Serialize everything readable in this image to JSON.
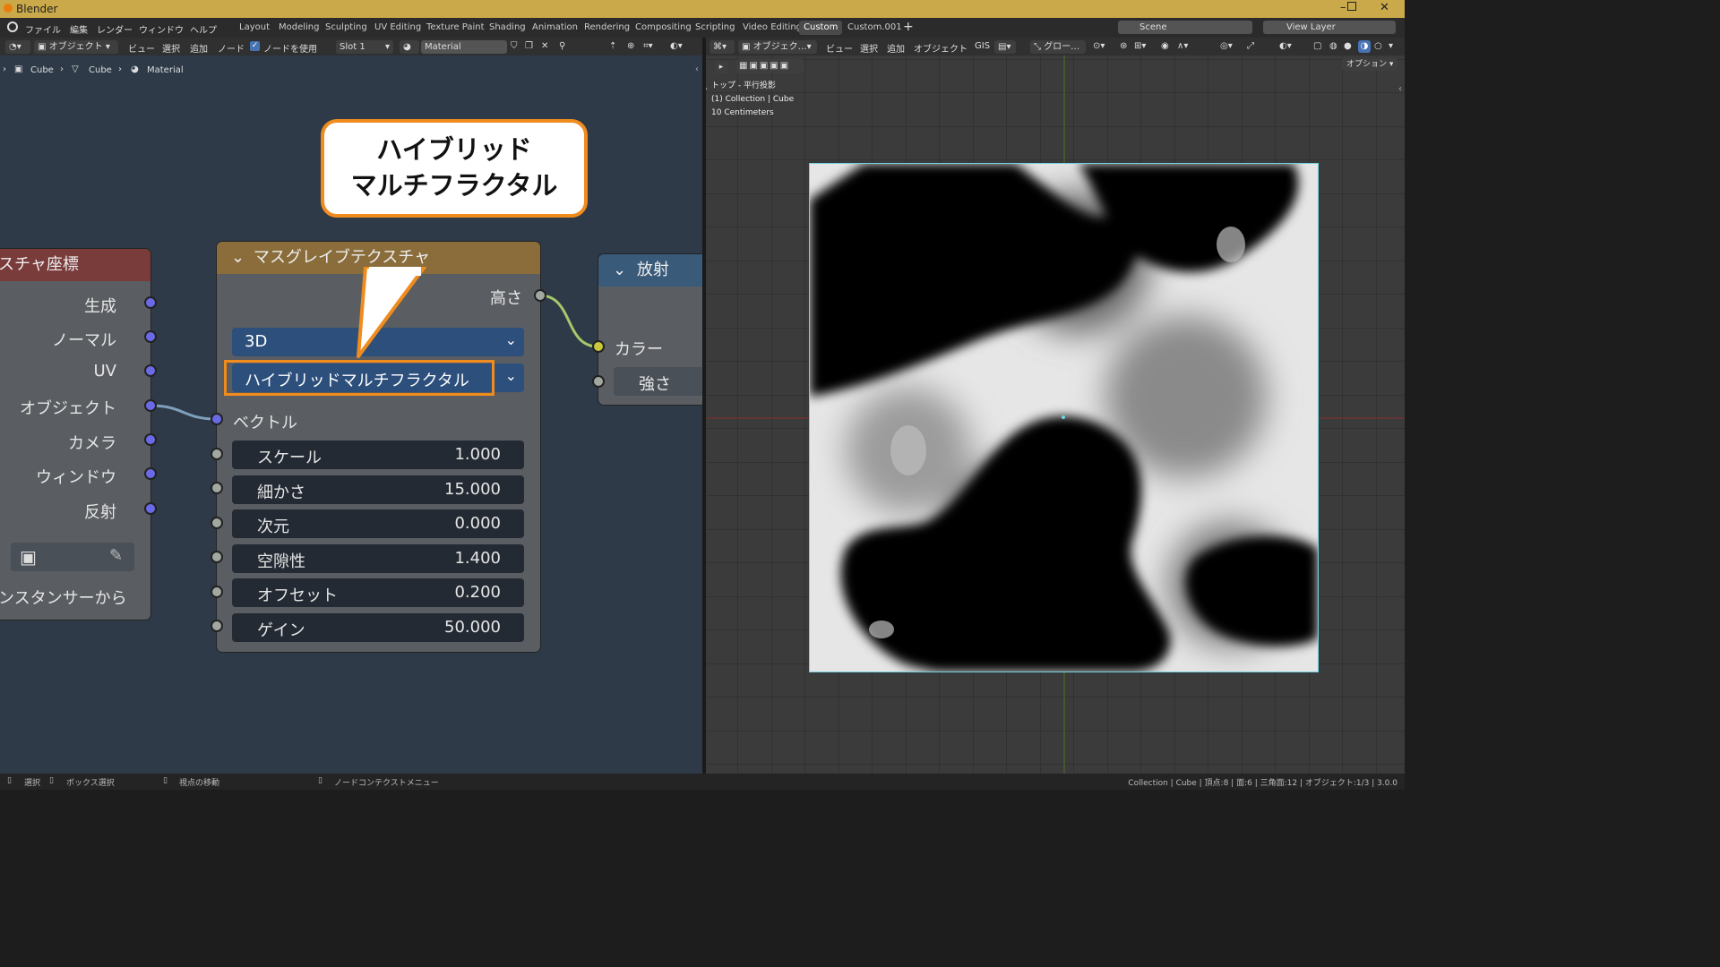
{
  "window": {
    "title": "Blender"
  },
  "menu": [
    "ファイル",
    "編集",
    "レンダー",
    "ウィンドウ",
    "ヘルプ"
  ],
  "workspaces": [
    "Layout",
    "Modeling",
    "Sculpting",
    "UV Editing",
    "Texture Paint",
    "Shading",
    "Animation",
    "Rendering",
    "Compositing",
    "Scripting",
    "Video Editing",
    "Custom",
    "Custom.001"
  ],
  "active_workspace": "Custom",
  "scene": "Scene",
  "view_layer": "View Layer",
  "node_header": {
    "mode": "オブジェクト",
    "view": "ビュー",
    "select": "選択",
    "add": "追加",
    "node": "ノード",
    "use_nodes": "ノードを使用",
    "slot": "Slot 1",
    "material": "Material"
  },
  "breadcrumb": [
    "Cube",
    "Cube",
    "Material"
  ],
  "nodes": {
    "texcoord": {
      "title": "スチャ座標",
      "outputs": [
        "生成",
        "ノーマル",
        "UV",
        "オブジェクト",
        "カメラ",
        "ウィンドウ",
        "反射"
      ],
      "from_instancer": "ンスタンサーから"
    },
    "musgrave": {
      "title": "マスグレイブテクスチャ",
      "output": "高さ",
      "dimension": "3D",
      "type": "ハイブリッドマルチフラクタル",
      "vector": "ベクトル",
      "fields": [
        {
          "name": "スケール",
          "value": "1.000"
        },
        {
          "name": "細かさ",
          "value": "15.000"
        },
        {
          "name": "次元",
          "value": "0.000"
        },
        {
          "name": "空隙性",
          "value": "1.400"
        },
        {
          "name": "オフセット",
          "value": "0.200"
        },
        {
          "name": "ゲイン",
          "value": "50.000"
        }
      ]
    },
    "emission": {
      "title": "放射",
      "color": "カラー",
      "strength": "強さ"
    }
  },
  "callout": {
    "line1": "ハイブリッド",
    "line2": "マルチフラクタル"
  },
  "viewport_header": {
    "mode": "オブジェク…",
    "view": "ビュー",
    "select": "選択",
    "add": "追加",
    "object": "オブジェクト",
    "gis": "GIS",
    "transform": "グロー…",
    "options": "オプション"
  },
  "viewport_info": [
    "トップ - 平行投影",
    "(1) Collection | Cube",
    "10 Centimeters"
  ],
  "status": {
    "select": "選択",
    "box_select": "ボックス選択",
    "move_view": "視点の移動",
    "context_menu": "ノードコンテクストメニュー",
    "stats": "Collection | Cube | 頂点:8 | 面:6 | 三角面:12 | オブジェクト:1/3 | 3.0.0"
  },
  "colors": {
    "accent_orange": "#f08c1e",
    "vector_socket": "#6a6ae8",
    "float_socket": "#a1a8a1",
    "color_socket": "#c8c83a",
    "texture_header": "#8a6d3b",
    "shader_header": "#3a5a7a"
  }
}
